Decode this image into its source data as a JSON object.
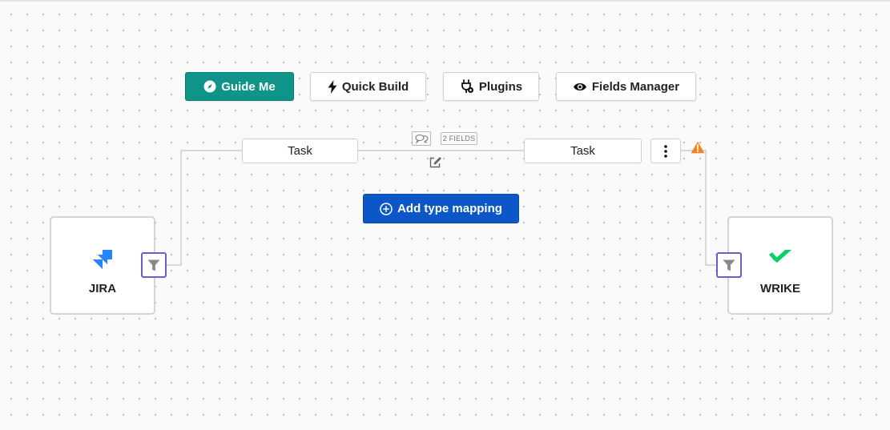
{
  "toolbar": {
    "guide_me": "Guide Me",
    "quick_build": "Quick Build",
    "plugins": "Plugins",
    "fields_manager": "Fields Manager"
  },
  "mapping": {
    "left_type": "Task",
    "right_type": "Task",
    "fields_badge": "2 FIELDS",
    "add_type_mapping": "Add type mapping"
  },
  "apps": {
    "left": {
      "name": "JIRA",
      "icon": "jira-logo"
    },
    "right": {
      "name": "WRIKE",
      "icon": "wrike-logo"
    }
  },
  "colors": {
    "primary_teal": "#0e9488",
    "action_blue": "#0b57c8",
    "filter_border": "#6b5fc7",
    "warning_orange": "#f5821f",
    "jira_blue": "#2684ff",
    "wrike_green": "#08cf65"
  },
  "icons": {
    "guide_me": "compass-icon",
    "quick_build": "bolt-icon",
    "plugins": "plug-icon",
    "fields_manager": "eye-icon",
    "comment": "chat-icon",
    "edit": "edit-icon",
    "more": "vertical-dots-icon",
    "warning": "warning-icon",
    "filter": "filter-icon",
    "add": "plus-circle-icon"
  }
}
